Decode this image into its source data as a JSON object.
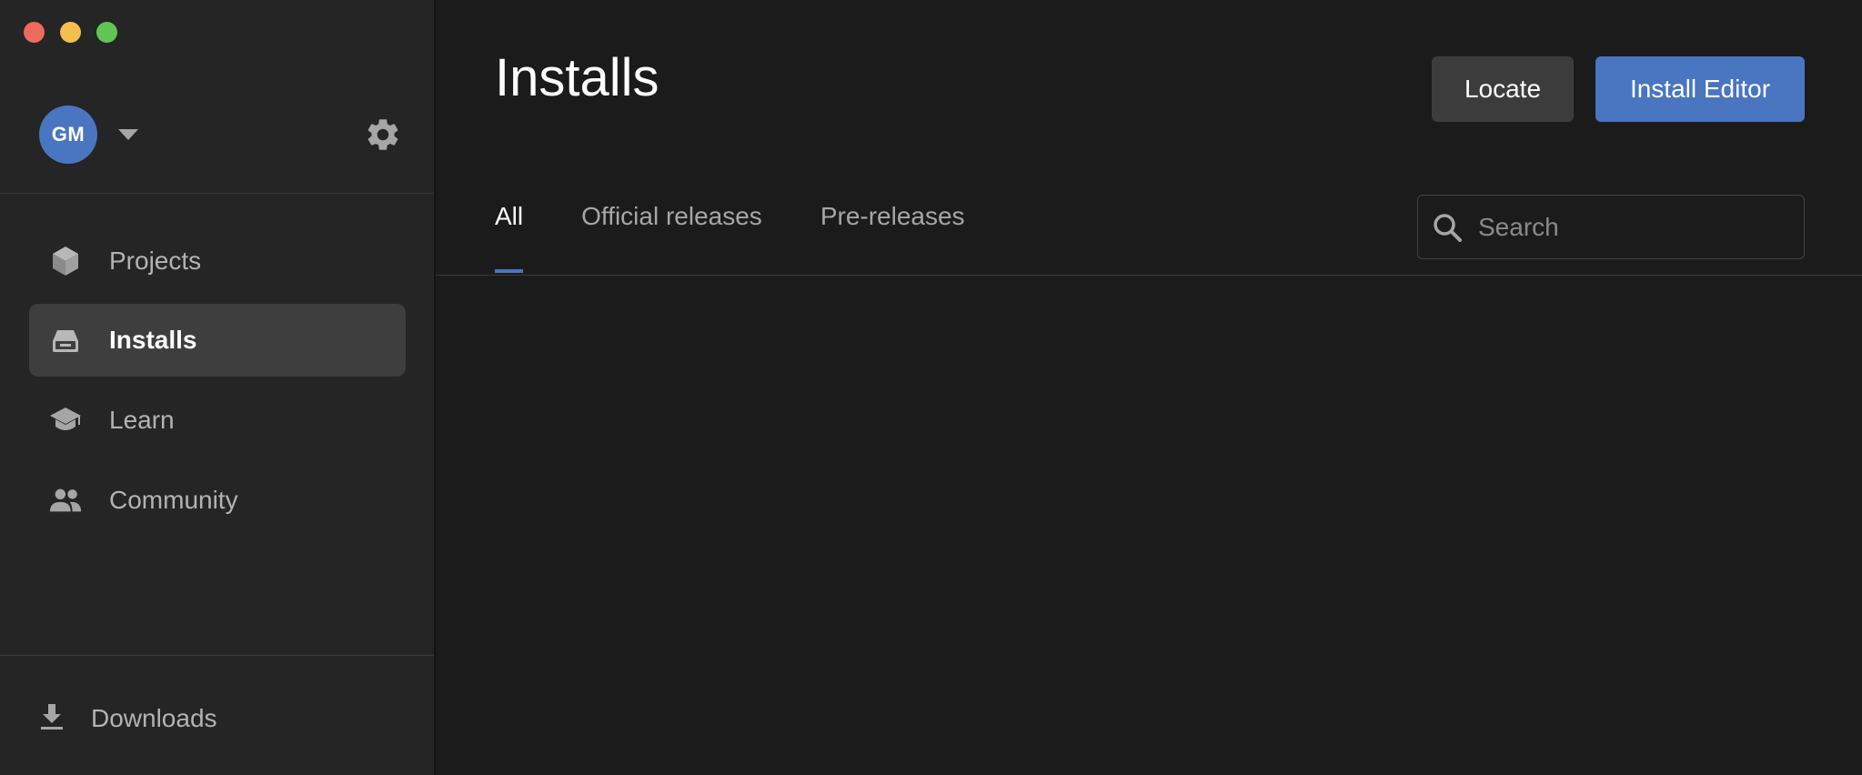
{
  "window": {
    "traffic_lights": [
      "close",
      "minimize",
      "zoom"
    ]
  },
  "sidebar": {
    "user": {
      "initials": "GM",
      "avatar_color": "#4a75c0"
    },
    "settings_icon": "gear-icon",
    "nav_items": [
      {
        "label": "Projects",
        "icon": "cube-icon",
        "active": false
      },
      {
        "label": "Installs",
        "icon": "drive-icon",
        "active": true
      },
      {
        "label": "Learn",
        "icon": "graduation-cap-icon",
        "active": false
      },
      {
        "label": "Community",
        "icon": "people-icon",
        "active": false
      }
    ],
    "downloads": {
      "label": "Downloads",
      "icon": "download-icon"
    }
  },
  "main": {
    "title": "Installs",
    "buttons": {
      "locate": "Locate",
      "install_editor": "Install Editor"
    },
    "tabs": [
      {
        "label": "All",
        "active": true
      },
      {
        "label": "Official releases",
        "active": false
      },
      {
        "label": "Pre-releases",
        "active": false
      }
    ],
    "search": {
      "placeholder": "Search",
      "value": ""
    }
  },
  "colors": {
    "accent": "#4a75c0",
    "background": "#1b1b1b",
    "sidebar": "#252525",
    "active_nav": "#3e3e3e"
  }
}
